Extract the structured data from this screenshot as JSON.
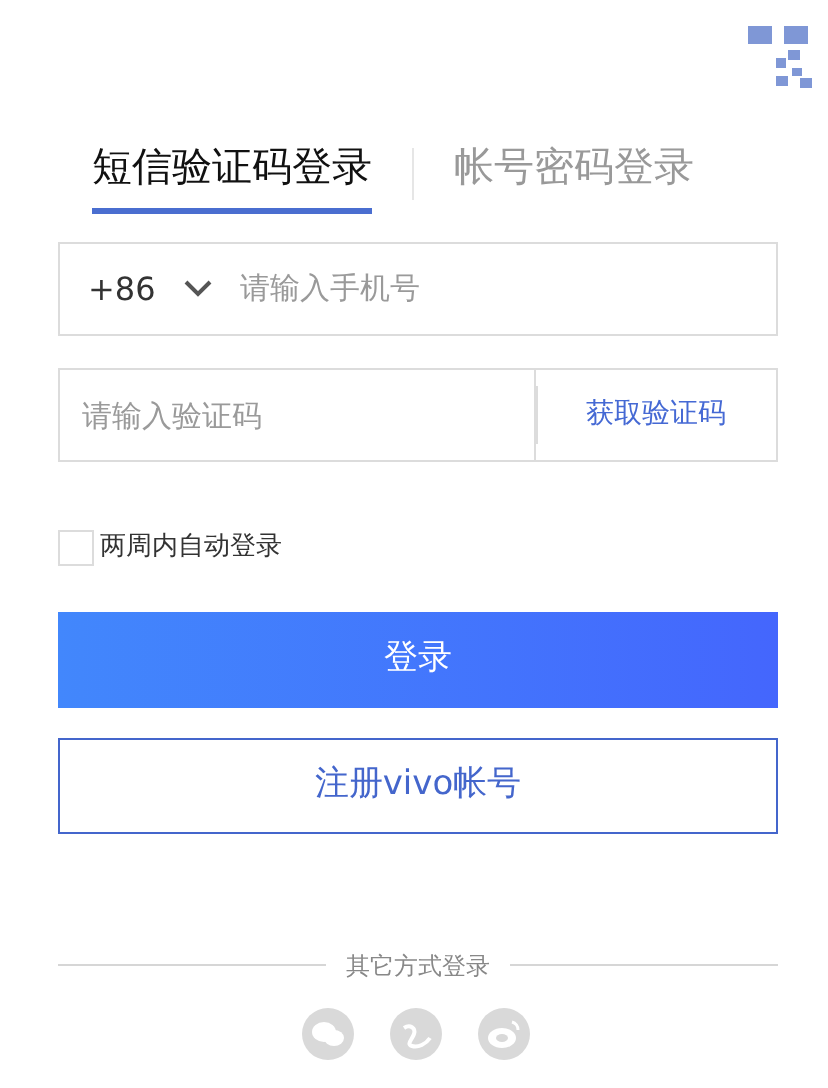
{
  "tabs": [
    {
      "label": "短信验证码登录",
      "selected": true
    },
    {
      "label": "帐号密码登录",
      "selected": false
    }
  ],
  "phone": {
    "country_code": "+86",
    "placeholder": "请输入手机号"
  },
  "code": {
    "placeholder": "请输入验证码",
    "action": "获取验证码"
  },
  "remember": {
    "label": "两周内自动登录",
    "checked": false
  },
  "login_button": "登录",
  "register_button": "注册vivo帐号",
  "other_login": {
    "label": "其它方式登录",
    "methods": [
      {
        "kind": "wechat"
      },
      {
        "kind": "qq"
      },
      {
        "kind": "weibo"
      }
    ]
  }
}
